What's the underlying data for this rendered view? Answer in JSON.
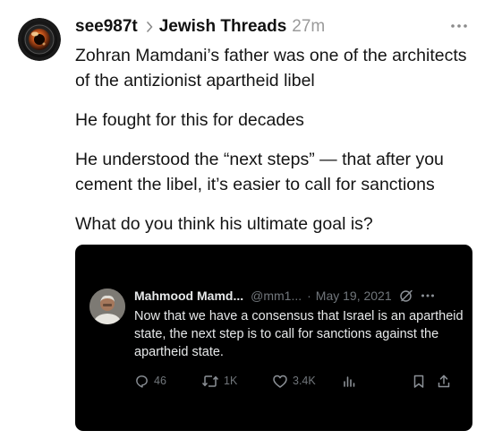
{
  "post": {
    "username": "see987t",
    "community": "Jewish Threads",
    "time_ago": "27m",
    "paragraphs": [
      "Zohran Mamdani’s father was one of the architects of the antizionist apartheid libel",
      "He fought for this for decades",
      "He understood the “next steps” — that after you cement the libel, it’s easier to call for sanctions",
      "What do you think his ultimate goal is?"
    ]
  },
  "embedded_tweet": {
    "name": "Mahmood Mamd...",
    "handle": "@mm1...",
    "separator": "·",
    "date": "May 19, 2021",
    "text": "Now that we have a consensus that Israel is an apartheid state, the next step is to call for sanctions against the apartheid state.",
    "replies": "46",
    "reposts": "1K",
    "likes": "3.4K"
  },
  "colors": {
    "embed_background": "#000000",
    "muted": "#71767b",
    "tweet_text": "#e7e9ea"
  },
  "icons": [
    "camera-lens-avatar",
    "chevron-right-icon",
    "more-dots-icon",
    "grok-icon",
    "reply-icon",
    "repost-icon",
    "like-icon",
    "views-icon",
    "bookmark-icon",
    "share-icon"
  ]
}
